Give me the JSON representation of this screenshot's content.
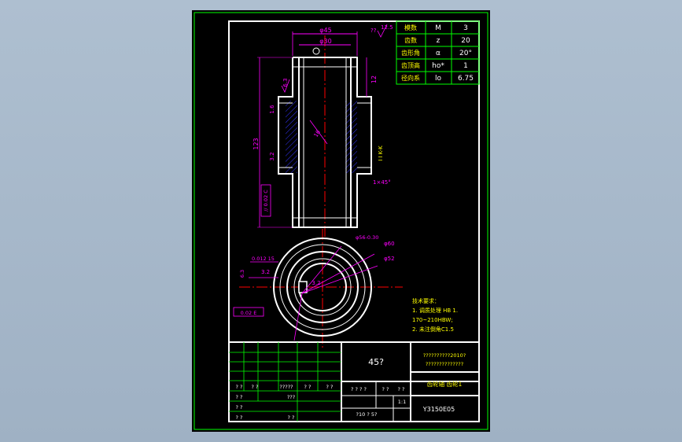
{
  "colors": {
    "background": "#aebfd0",
    "sheet": "#000000",
    "border": "#ffffff",
    "outer_border": "#00ff00",
    "dimension": "#ff00ff",
    "centerline": "#ff0000",
    "table": "#00ff00",
    "hatch": "#3333ff",
    "note_text": "#ffff00",
    "value_text": "#ffffff"
  },
  "gear_table": {
    "rows": [
      {
        "name": "模数",
        "symbol": "M",
        "value": "3"
      },
      {
        "name": "齿数",
        "symbol": "z",
        "value": "20"
      },
      {
        "name": "齿形角",
        "symbol": "α",
        "value": "20°"
      },
      {
        "name": "齿顶高",
        "symbol": "ho*",
        "value": "1"
      },
      {
        "name": "径向系",
        "symbol": "lo",
        "value": "6.75"
      }
    ]
  },
  "dimensions": {
    "d45": "φ45",
    "d30": "φ30",
    "ra_top": "12.5",
    "qq": "??",
    "r63": "6.3",
    "r16": "1.6",
    "r32": "3.2",
    "len123": "123",
    "len12": "12",
    "len16": "16",
    "r16b": "1.6",
    "section": "I I K-K",
    "chamfer": "1×45°",
    "tol_box": "// 0.02 C",
    "d56": "φ56-0.30",
    "d60": "φ60",
    "d52": "φ52",
    "tol_top": "0.012 15",
    "r63b": "6.3",
    "r32b": "3.2",
    "r32c": "3.2",
    "tol_box2": "0.02 E"
  },
  "notes": {
    "title": "技术要求：",
    "line1": "1.  调质处理 HB 1.",
    "line2": "170~210HBW;",
    "line3": "2.  未注倒角C1.5"
  },
  "title_block": {
    "material": "45?",
    "school_line1": "??????????2010?",
    "school_line2": "??????????????",
    "part_name": "齿轮轴 齿轮1",
    "drawing_no": "Y3150E05",
    "scale": "1:1",
    "sheet_label": "?10  ? 5?",
    "left_cells": [
      "? ?",
      "? ?",
      "?????",
      "? ?",
      "? ?",
      "? ?",
      "???",
      "? ?",
      "? ?",
      "? ?",
      "? ?",
      "? ?"
    ],
    "right_cells": [
      "? ? ? ?",
      "? ?",
      "? ?",
      "1:1"
    ]
  }
}
